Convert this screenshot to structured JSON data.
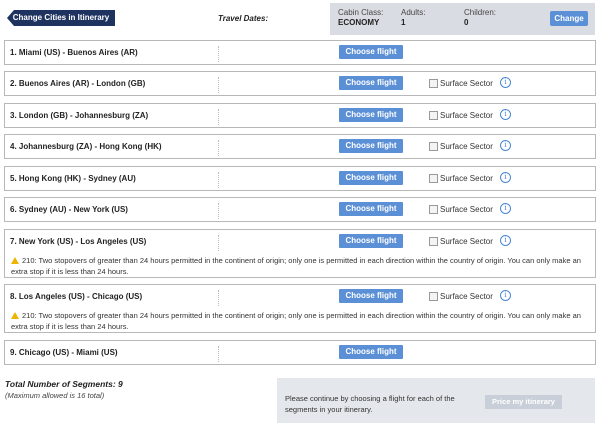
{
  "header": {
    "change_cities_label": "Change Cities in Itinerary",
    "travel_dates_label": "Travel Dates:",
    "cabin_class_label": "Cabin Class:",
    "cabin_class_value": "ECONOMY",
    "adults_label": "Adults:",
    "adults_value": "1",
    "children_label": "Children:",
    "children_value": "0",
    "change_button": "Change"
  },
  "segments": [
    {
      "route": "1. Miami (US) - Buenos Aires (AR)",
      "button": "Choose flight"
    },
    {
      "route": "2. Buenos Aires (AR) - London (GB)",
      "button": "Choose flight",
      "surface": "Surface Sector"
    },
    {
      "route": "3. London (GB) - Johannesburg (ZA)",
      "button": "Choose flight",
      "surface": "Surface Sector"
    },
    {
      "route": "4. Johannesburg (ZA) - Hong Kong (HK)",
      "button": "Choose flight",
      "surface": "Surface Sector"
    },
    {
      "route": "5. Hong Kong (HK) - Sydney (AU)",
      "button": "Choose flight",
      "surface": "Surface Sector"
    },
    {
      "route": "6. Sydney (AU) - New York (US)",
      "button": "Choose flight",
      "surface": "Surface Sector"
    },
    {
      "route": "7. New York (US) - Los Angeles (US)",
      "button": "Choose flight",
      "surface": "Surface Sector",
      "warning": "210: Two stopovers of greater than 24 hours permitted in the continent of origin; only one is permitted in each direction within the country of origin. You can only make an extra stop if it is less than 24 hours."
    },
    {
      "route": "8. Los Angeles (US) - Chicago (US)",
      "button": "Choose flight",
      "surface": "Surface Sector",
      "warning": "210: Two stopovers of greater than 24 hours permitted in the continent of origin; only one is permitted in each direction within the country of origin. You can only make an extra stop if it is less than 24 hours."
    },
    {
      "route": "9. Chicago (US) - Miami (US)",
      "button": "Choose flight"
    }
  ],
  "footer": {
    "total_segments": "Total Number of Segments: 9",
    "max_allowed": "(Maximum allowed is 16 total)",
    "message": "Please continue by choosing a flight for each of the segments in your itinerary.",
    "price_button": "Price my itinerary"
  },
  "colors": {
    "navy": "#1f3361",
    "button_blue": "#5b8fd6",
    "info_blue": "#4a86d4",
    "warning_yellow": "#f0b400",
    "panel_gray": "#d9dde3"
  },
  "icons": {
    "info": "info-icon",
    "warning": "warning-icon"
  }
}
